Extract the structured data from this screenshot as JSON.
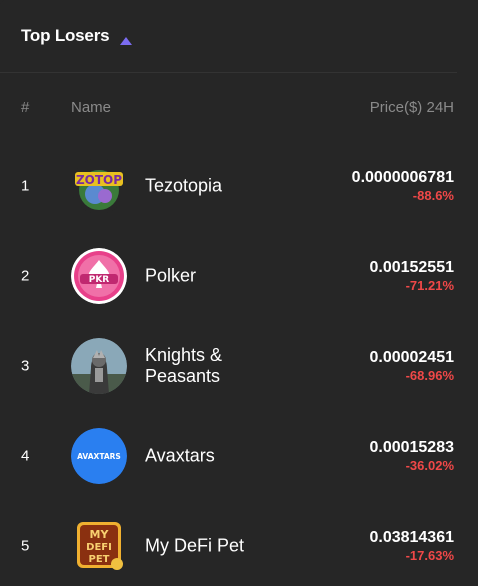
{
  "header": {
    "title": "Top Losers",
    "sort_icon": "triangle-up-icon",
    "accent": "#7b6cf0"
  },
  "columns": {
    "rank": "#",
    "name": "Name",
    "price": "Price($) 24H"
  },
  "rows": [
    {
      "rank": "1",
      "name": "Tezotopia",
      "price": "0.0000006781",
      "change": "-88.6%",
      "logo": "tezotopia-logo"
    },
    {
      "rank": "2",
      "name": "Polker",
      "price": "0.00152551",
      "change": "-71.21%",
      "logo": "polker-logo"
    },
    {
      "rank": "3",
      "name": "Knights & Peasants",
      "price": "0.00002451",
      "change": "-68.96%",
      "logo": "knights-peasants-logo"
    },
    {
      "rank": "4",
      "name": "Avaxtars",
      "price": "0.00015283",
      "change": "-36.02%",
      "logo": "avaxtars-logo",
      "logo_text": "AVAXTARS"
    },
    {
      "rank": "5",
      "name": "My DeFi Pet",
      "price": "0.03814361",
      "change": "-17.63%",
      "logo": "my-defi-pet-logo"
    }
  ],
  "colors": {
    "background": "#262626",
    "negative": "#f04848",
    "muted": "#8a8a8a"
  }
}
